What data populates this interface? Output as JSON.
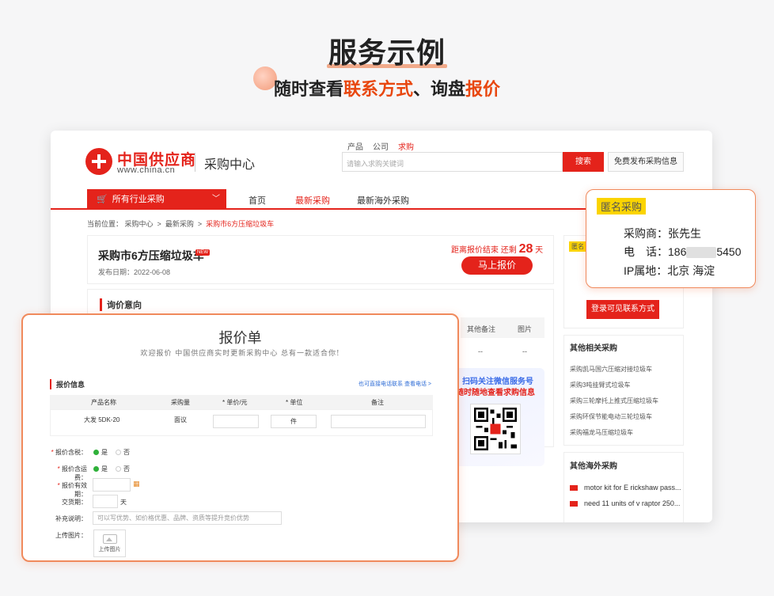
{
  "hero": {
    "title": "服务示例",
    "sub_1": "随时查看",
    "sub_2": "联系方式",
    "sub_3": "、询盘",
    "sub_4": "报价"
  },
  "site": {
    "logo_name": "中国供应商",
    "logo_url": "www.china.cn",
    "center_title": "采购中心",
    "search_tabs": [
      "产品",
      "公司",
      "求购"
    ],
    "search_placeholder": "请输入求购关键词",
    "search_button": "搜索",
    "publish_button": "免费发布采购信息",
    "nav_category": "所有行业采购",
    "nav_items": [
      "首页",
      "最新采购",
      "最新海外采购"
    ]
  },
  "breadcrumb": {
    "label": "当前位置：",
    "items": [
      "采购中心",
      "最新采购",
      "采购市6方压缩垃圾车"
    ]
  },
  "detail": {
    "title": "采购市6方压缩垃圾车",
    "new_badge": "NEW",
    "date": "发布日期：2022-06-08",
    "deadline_prefix": "距离报价结束 还剩",
    "deadline_days": "28",
    "deadline_unit": "天",
    "quote_button": "马上报价",
    "intent_title": "询价意向",
    "intent_cols": [
      "其他备注",
      "图片"
    ],
    "intent_vals": [
      "--",
      "--"
    ]
  },
  "wechat": {
    "line1": "扫码关注微信服务号",
    "line2": "随时随地查看求购信息"
  },
  "side": {
    "badge": "匿名",
    "login_button": "登录可见联系方式",
    "related_title": "其他相关采购",
    "related_items": [
      "采购凯马国六压缩对接垃圾车",
      "采购3吨挂臂式垃圾车",
      "采购三轮摩托上推式压缩垃圾车",
      "采购环保节能电动三轮垃圾车",
      "采购福龙马压缩垃圾车"
    ],
    "overseas_title": "其他海外采购",
    "overseas_items": [
      "motor kit for E rickshaw pass...",
      "need 11 units of v raptor 250..."
    ]
  },
  "popup": {
    "badge": "匿名采购",
    "buyer_label": "采购商：",
    "buyer_value": "张先生",
    "phone_label": "电　话：",
    "phone_prefix": "186",
    "phone_suffix": "5450",
    "ip_label": "IP属地：",
    "ip_value": "北京 海淀"
  },
  "form": {
    "title": "报价单",
    "subtitle": "欢迎报价 中国供应商实时更新采购中心 总有一款适合你!",
    "section_title": "报价信息",
    "section_link": "也可直接电话联系 查看电话 >",
    "columns": [
      "产品名称",
      "采购量",
      "* 单价/元",
      "* 单位",
      "备注"
    ],
    "row": {
      "name": "大发 5DK-20",
      "qty": "面议",
      "unit": "件"
    },
    "tax_label": "报价含税：",
    "ship_label": "报价含运费：",
    "valid_label": "报价有效期：",
    "delivery_label": "交货期：",
    "delivery_unit": "天",
    "note_label": "补充说明：",
    "note_placeholder": "可以写优势、如价格优惠、品牌、资质等提升竞价优势",
    "upload_label": "上传图片：",
    "upload_button": "上传图片",
    "yes": "是",
    "no": "否"
  }
}
